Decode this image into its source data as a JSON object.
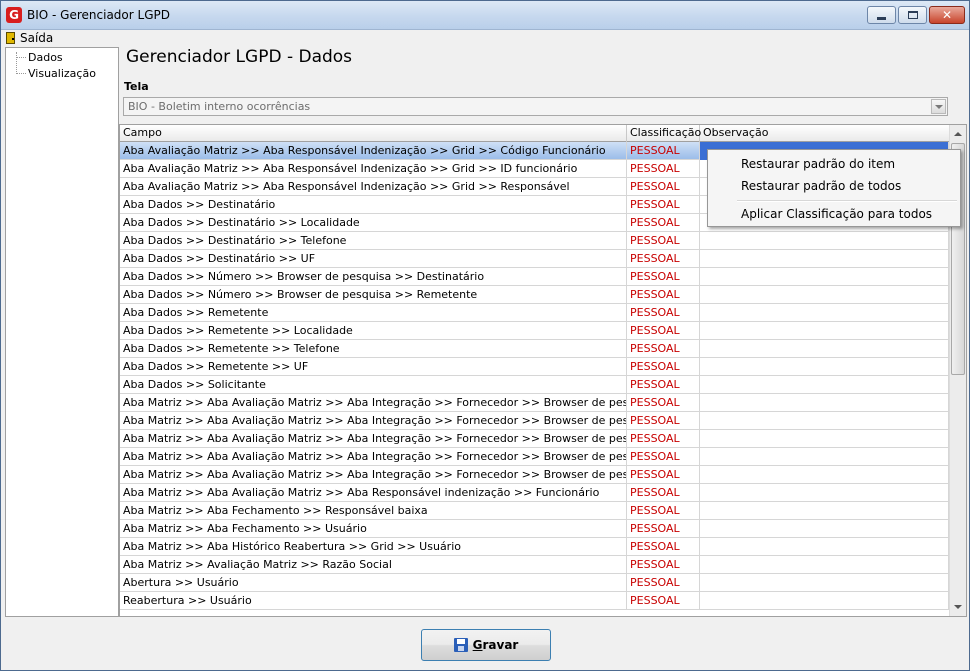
{
  "window": {
    "title": "BIO - Gerenciador LGPD"
  },
  "menu": {
    "exit_label": "Saída"
  },
  "tree": {
    "items": [
      "Dados",
      "Visualização"
    ]
  },
  "page": {
    "title": "Gerenciador LGPD - Dados",
    "tela_label": "Tela",
    "tela_value": "BIO - Boletim interno ocorrências"
  },
  "grid": {
    "columns": [
      "Campo",
      "Classificação",
      "Observação"
    ],
    "rows": [
      {
        "campo": "Aba Avaliação Matriz >> Aba Responsável Indenização >> Grid >> Código Funcionário",
        "classificacao": "PESSOAL",
        "observacao": ""
      },
      {
        "campo": "Aba Avaliação Matriz >> Aba Responsável Indenização >> Grid >> ID funcionário",
        "classificacao": "PESSOAL",
        "observacao": ""
      },
      {
        "campo": "Aba Avaliação Matriz >> Aba Responsável Indenização >> Grid >> Responsável",
        "classificacao": "PESSOAL",
        "observacao": ""
      },
      {
        "campo": "Aba Dados >> Destinatário",
        "classificacao": "PESSOAL",
        "observacao": ""
      },
      {
        "campo": "Aba Dados >> Destinatário >> Localidade",
        "classificacao": "PESSOAL",
        "observacao": ""
      },
      {
        "campo": "Aba Dados >> Destinatário >> Telefone",
        "classificacao": "PESSOAL",
        "observacao": ""
      },
      {
        "campo": "Aba Dados >> Destinatário >> UF",
        "classificacao": "PESSOAL",
        "observacao": ""
      },
      {
        "campo": "Aba Dados >> Número >> Browser de pesquisa >> Destinatário",
        "classificacao": "PESSOAL",
        "observacao": ""
      },
      {
        "campo": "Aba Dados >> Número >> Browser de pesquisa >> Remetente",
        "classificacao": "PESSOAL",
        "observacao": ""
      },
      {
        "campo": "Aba Dados >> Remetente",
        "classificacao": "PESSOAL",
        "observacao": ""
      },
      {
        "campo": "Aba Dados >> Remetente >> Localidade",
        "classificacao": "PESSOAL",
        "observacao": ""
      },
      {
        "campo": "Aba Dados >> Remetente >> Telefone",
        "classificacao": "PESSOAL",
        "observacao": ""
      },
      {
        "campo": "Aba Dados >> Remetente >> UF",
        "classificacao": "PESSOAL",
        "observacao": ""
      },
      {
        "campo": "Aba Dados >> Solicitante",
        "classificacao": "PESSOAL",
        "observacao": ""
      },
      {
        "campo": "Aba Matriz >> Aba Avaliação Matriz >> Aba Integração >> Fornecedor >> Browser de pesquisa >> Inscri...",
        "classificacao": "PESSOAL",
        "observacao": ""
      },
      {
        "campo": "Aba Matriz >> Aba Avaliação Matriz >> Aba Integração >> Fornecedor >> Browser de pesquisa >> Interno",
        "classificacao": "PESSOAL",
        "observacao": ""
      },
      {
        "campo": "Aba Matriz >> Aba Avaliação Matriz >> Aba Integração >> Fornecedor >> Browser de pesquisa >> Nome",
        "classificacao": "PESSOAL",
        "observacao": ""
      },
      {
        "campo": "Aba Matriz >> Aba Avaliação Matriz >> Aba Integração >> Fornecedor >> Browser de pesquisa >> Núm...",
        "classificacao": "PESSOAL",
        "observacao": ""
      },
      {
        "campo": "Aba Matriz >> Aba Avaliação Matriz >> Aba Integração >> Fornecedor >> Browser de pesquisa >> Razã...",
        "classificacao": "PESSOAL",
        "observacao": ""
      },
      {
        "campo": "Aba Matriz >> Aba Avaliação Matriz >> Aba Responsável indenização >> Funcionário",
        "classificacao": "PESSOAL",
        "observacao": ""
      },
      {
        "campo": "Aba Matriz >> Aba Fechamento >> Responsável baixa",
        "classificacao": "PESSOAL",
        "observacao": ""
      },
      {
        "campo": "Aba Matriz >> Aba Fechamento >> Usuário",
        "classificacao": "PESSOAL",
        "observacao": ""
      },
      {
        "campo": "Aba Matriz >> Aba Histórico Reabertura >> Grid >> Usuário",
        "classificacao": "PESSOAL",
        "observacao": ""
      },
      {
        "campo": "Aba Matriz >> Avaliação Matriz >> Razão Social",
        "classificacao": "PESSOAL",
        "observacao": ""
      },
      {
        "campo": "Abertura >> Usuário",
        "classificacao": "PESSOAL",
        "observacao": ""
      },
      {
        "campo": "Reabertura >> Usuário",
        "classificacao": "PESSOAL",
        "observacao": ""
      }
    ]
  },
  "context_menu": {
    "items": [
      "Restaurar padrão do item",
      "Restaurar padrão de todos",
      "Aplicar Classificação para todos"
    ]
  },
  "save_button": {
    "label_accel": "G",
    "label_rest": "ravar"
  }
}
